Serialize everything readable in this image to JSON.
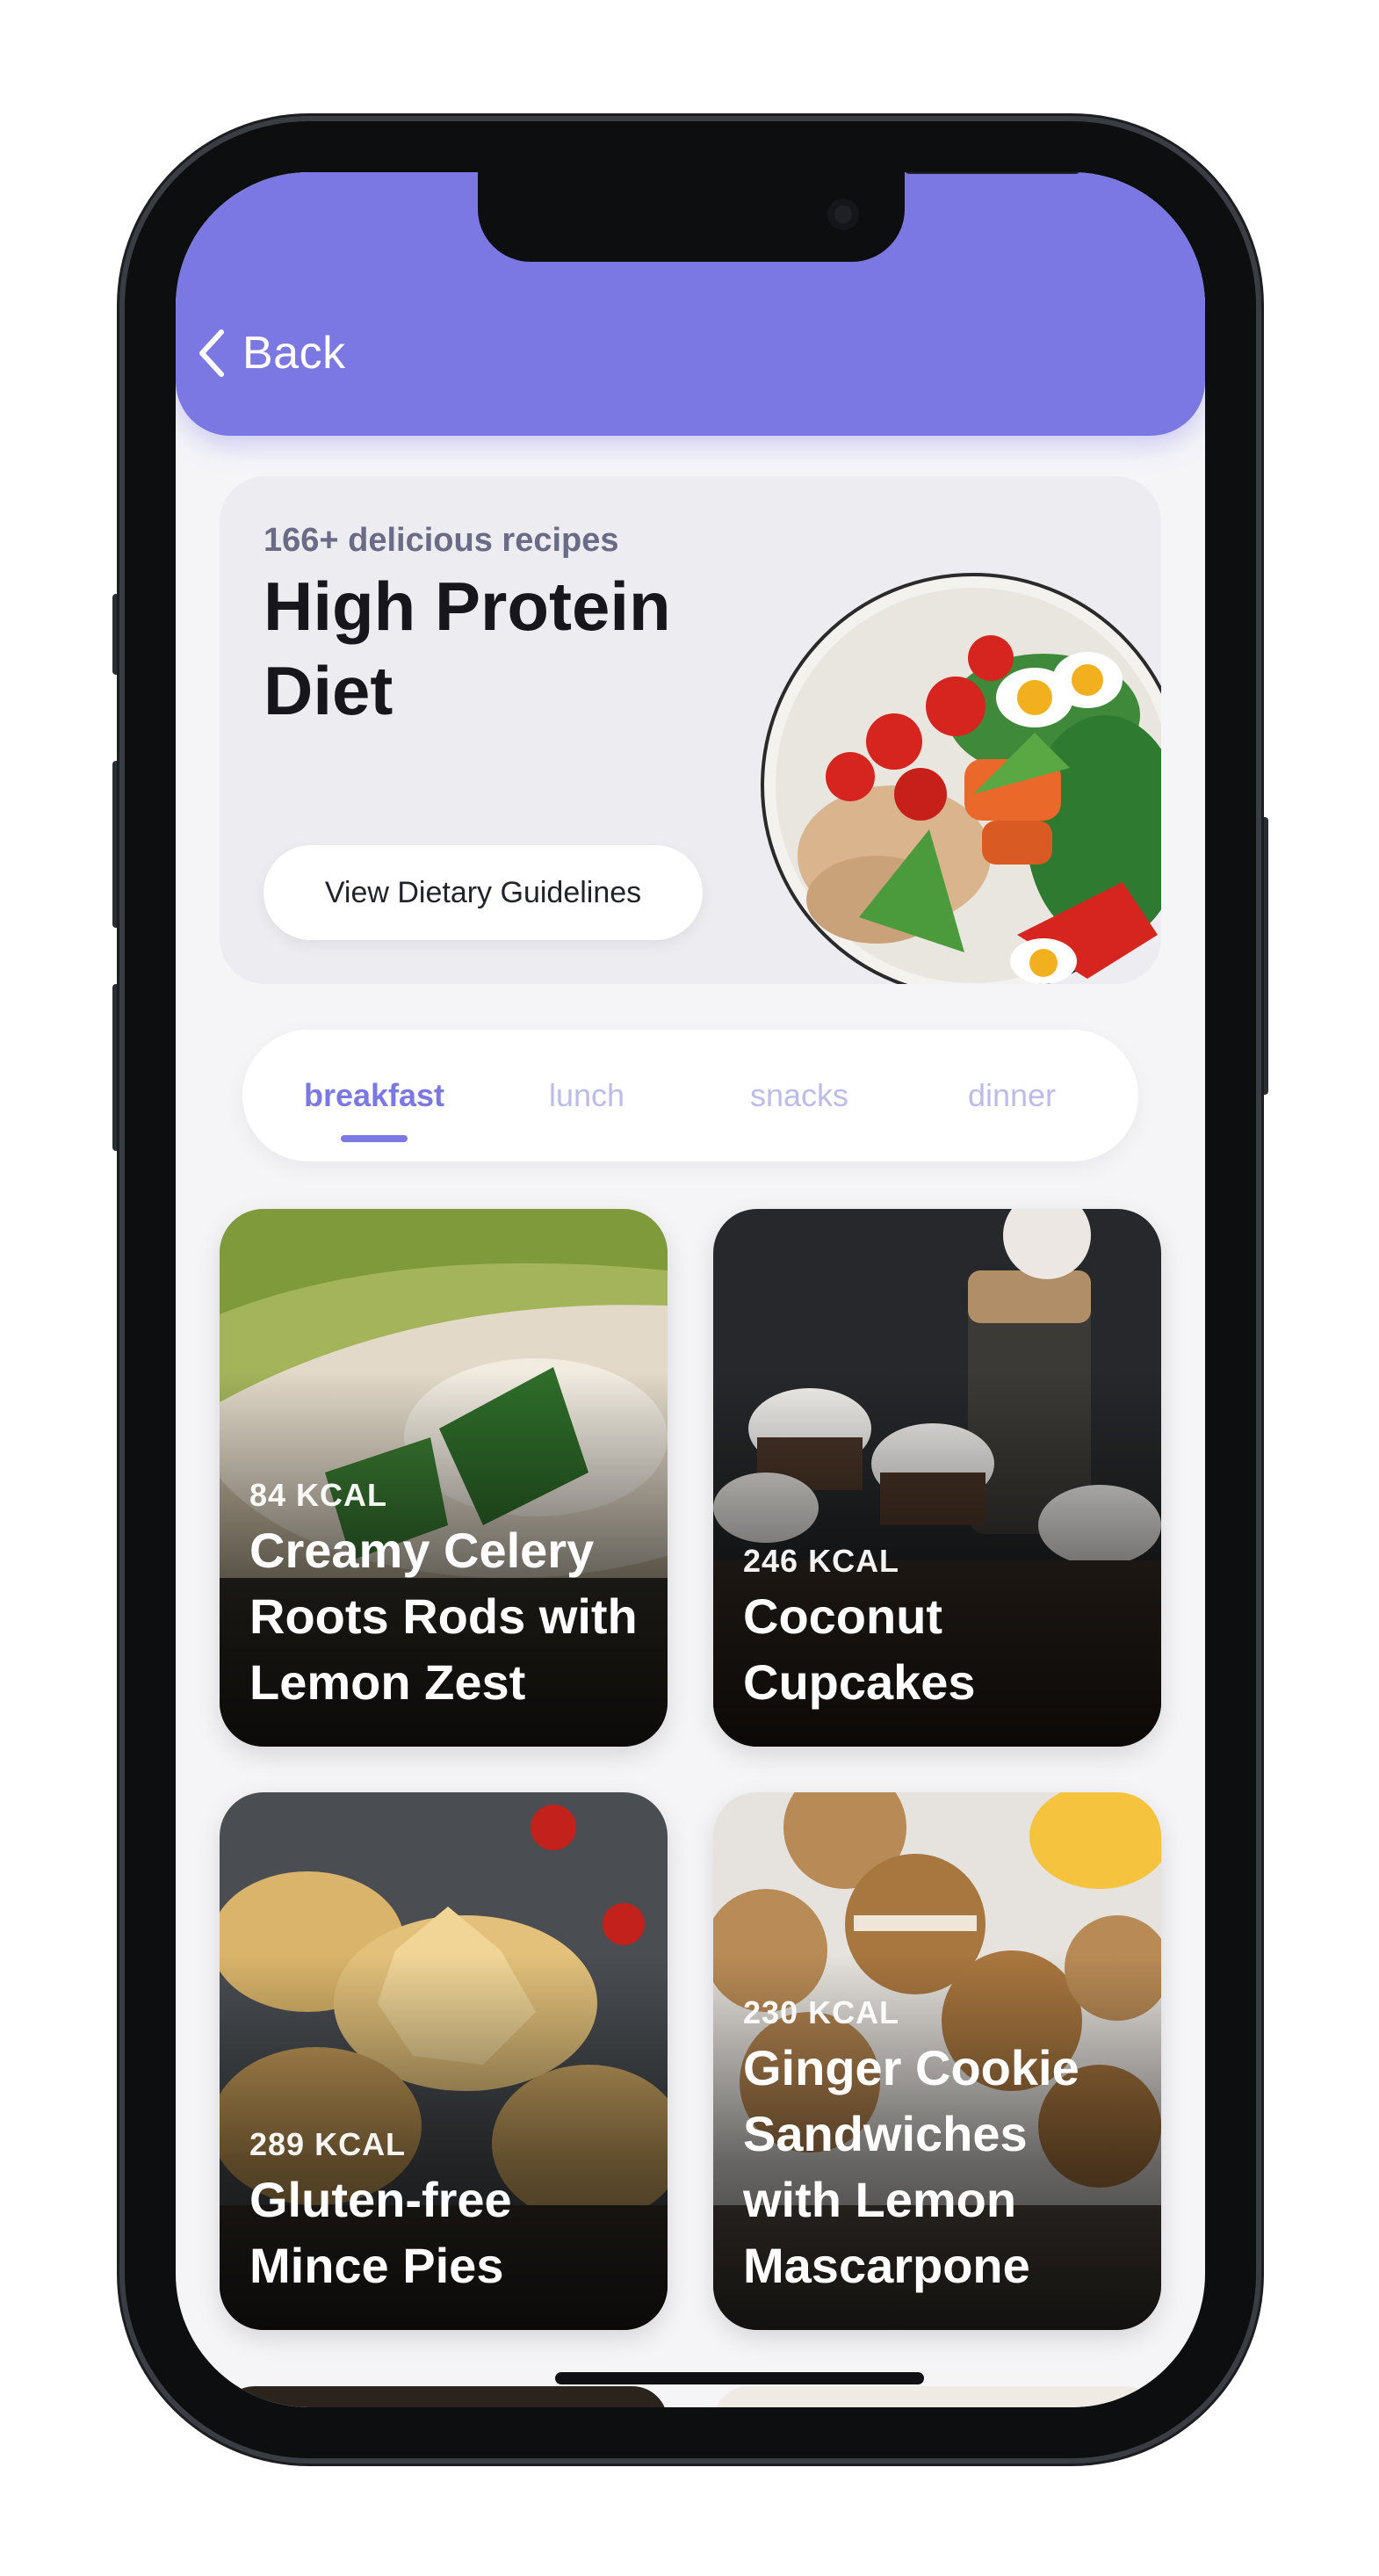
{
  "nav": {
    "back_label": "Back"
  },
  "hero": {
    "subtitle": "166+ delicious recipes",
    "title": "High Protein Diet",
    "button_label": "View Dietary Guidelines"
  },
  "tabs": [
    {
      "label": "breakfast",
      "active": true
    },
    {
      "label": "lunch",
      "active": false
    },
    {
      "label": "snacks",
      "active": false
    },
    {
      "label": "dinner",
      "active": false
    }
  ],
  "recipes": [
    {
      "kcal": "84 KCAL",
      "name": "Creamy Celery Roots Rods with Lemon Zest"
    },
    {
      "kcal": "246 KCAL",
      "name": "Coconut Cupcakes"
    },
    {
      "kcal": "289 KCAL",
      "name": "Gluten-free Mince Pies"
    },
    {
      "kcal": "230 KCAL",
      "name": "Ginger Cookie Sandwiches with Lemon Mascarpone"
    }
  ],
  "colors": {
    "accent": "#7b78e4",
    "background": "#f5f5f8",
    "hero_card": "#ececf1",
    "inactive_tab": "#bcbbe9"
  },
  "icons": {
    "back": "chevron-left-icon",
    "camera": "front-camera-icon"
  }
}
